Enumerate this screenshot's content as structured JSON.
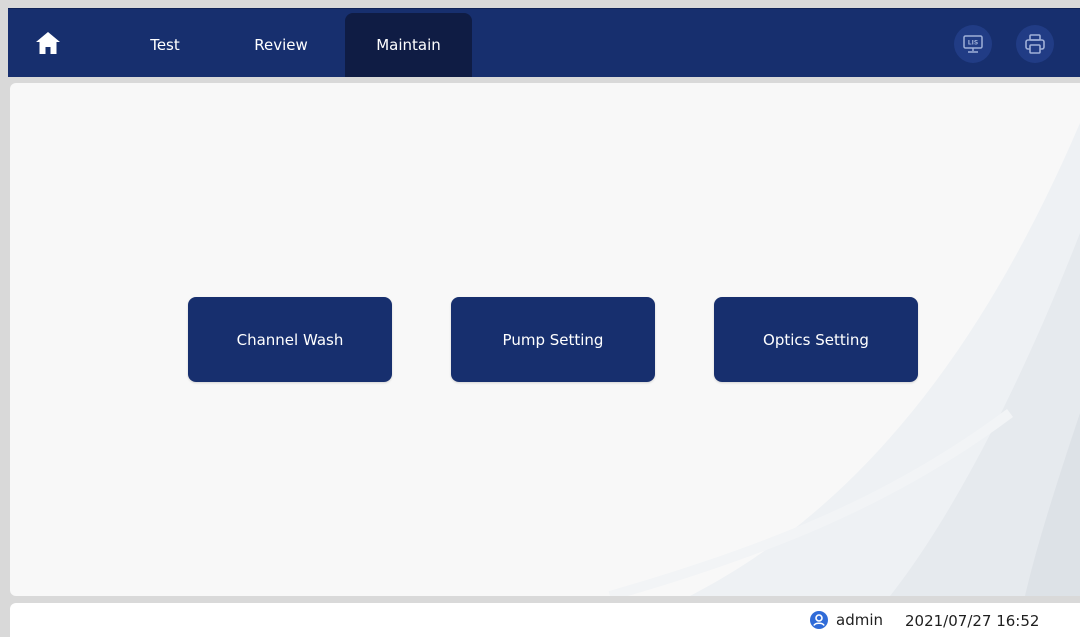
{
  "nav": {
    "home_icon": "home-icon",
    "tabs": [
      {
        "label": "Test",
        "active": false
      },
      {
        "label": "Review",
        "active": false
      },
      {
        "label": "Maintain",
        "active": true
      }
    ],
    "lis_icon": "lis-monitor-icon",
    "lis_icon_text": "LIS",
    "print_icon": "printer-icon"
  },
  "main": {
    "buttons": [
      {
        "label": "Channel Wash"
      },
      {
        "label": "Pump Setting"
      },
      {
        "label": "Optics Setting"
      }
    ]
  },
  "status": {
    "user_icon": "user-icon",
    "username": "admin",
    "datetime": "2021/07/27 16:52"
  },
  "colors": {
    "nav_bg": "#172f6e",
    "active_tab_bg": "#0f1c44",
    "button_bg": "#172f6e",
    "panel_bg": "#f8f8f8",
    "user_icon": "#2f6bd8"
  }
}
